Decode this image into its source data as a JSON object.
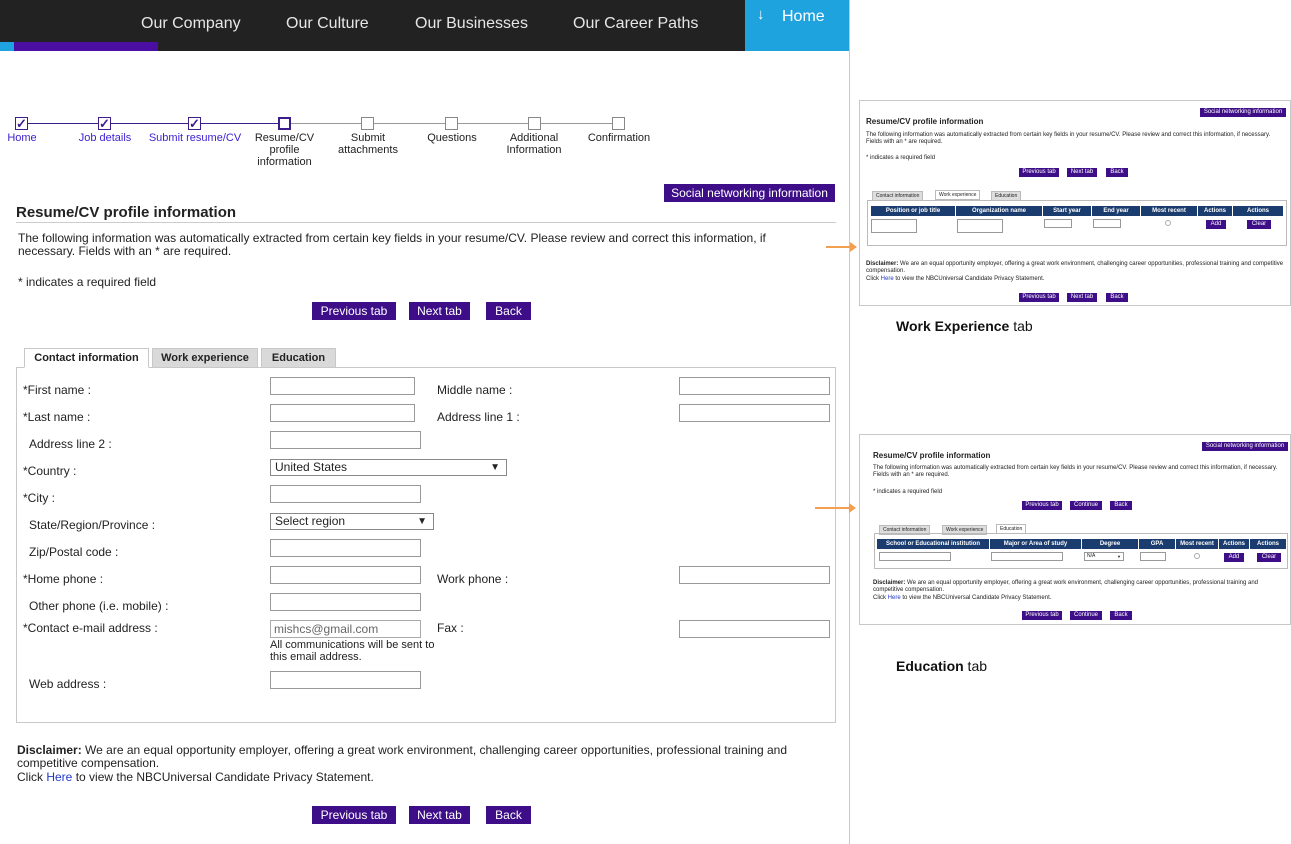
{
  "nav": {
    "items": [
      "Our Company",
      "Our Culture",
      "Our Businesses",
      "Our Career Paths"
    ],
    "home": "Home"
  },
  "steps": [
    "Home",
    "Job details",
    "Submit resume/CV",
    "Resume/CV profile information",
    "Submit attachments",
    "Questions",
    "Additional Information",
    "Confirmation"
  ],
  "social_btn": "Social networking information",
  "page_title": "Resume/CV profile information",
  "intro": "The following information was automatically extracted from certain key fields in your resume/CV. Please review and correct this information, if necessary. Fields with an * are required.",
  "required_note": "* indicates a required field",
  "buttons": {
    "prev": "Previous tab",
    "next": "Next tab",
    "back": "Back",
    "continue": "Continue"
  },
  "tabs": [
    "Contact information",
    "Work experience",
    "Education"
  ],
  "form": {
    "first_name": "*First name :",
    "middle_name": "Middle name :",
    "last_name": "*Last name :",
    "address1": "Address line 1 :",
    "address2": "Address line 2 :",
    "country": "*Country :",
    "country_value": "United States",
    "city": "*City :",
    "state": "State/Region/Province :",
    "state_value": "Select region",
    "zip": "Zip/Postal code :",
    "home_phone": "*Home phone :",
    "work_phone": "Work phone :",
    "other_phone": "Other phone (i.e. mobile) :",
    "email": "*Contact e-mail address :",
    "email_value": "mishcs@gmail.com",
    "email_note": "All communications will be sent to this email address.",
    "fax": "Fax :",
    "web": "Web address :"
  },
  "disclaimer": {
    "label": "Disclaimer:",
    "text": " We are an equal opportunity employer, offering a great work environment, challenging career opportunities, professional training and competitive compensation.",
    "click": "Click ",
    "here": "Here",
    "tail": " to view the NBCUniversal Candidate Privacy Statement."
  },
  "thumb_work": {
    "caption_bold": "Work Experience",
    "caption_rest": " tab",
    "columns": [
      "Position or job title",
      "Organization name",
      "Start year",
      "End year",
      "Most recent",
      "Actions",
      "Actions"
    ],
    "add": "Add",
    "clear": "Clear"
  },
  "thumb_edu": {
    "caption_bold": "Education",
    "caption_rest": " tab",
    "columns": [
      "School or Educational institution",
      "Major or Area of study",
      "Degree",
      "GPA",
      "Most recent",
      "Actions",
      "Actions"
    ],
    "degree_value": "N/A",
    "add": "Add",
    "clear": "Clear"
  }
}
